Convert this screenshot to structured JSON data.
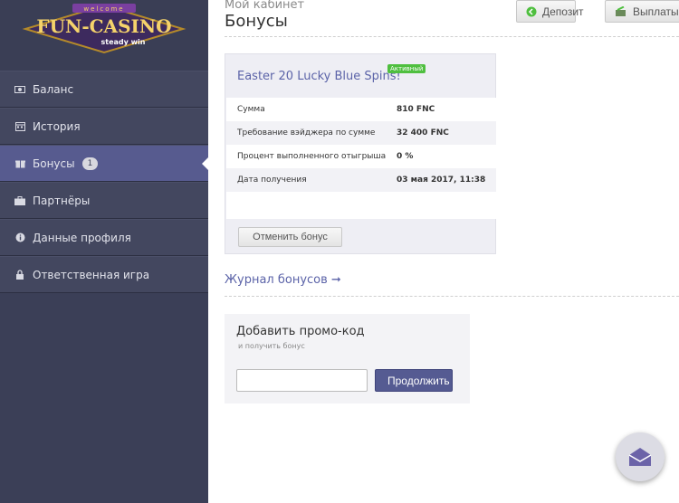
{
  "logo": {
    "top_text": "welcome",
    "main_text": "FUN-CASINO",
    "tagline": "steady win"
  },
  "sidebar": {
    "items": [
      {
        "label": "Баланс",
        "icon": "cash-icon"
      },
      {
        "label": "История",
        "icon": "calendar-icon"
      },
      {
        "label": "Бонусы",
        "icon": "gift-icon",
        "badge": "1",
        "active": true
      },
      {
        "label": "Партнёры",
        "icon": "briefcase-icon"
      },
      {
        "label": "Данные профиля",
        "icon": "info-icon"
      },
      {
        "label": "Ответственная игра",
        "icon": "lock-icon"
      }
    ]
  },
  "header": {
    "cabinet": "Мой кабинет",
    "title": "Бонусы",
    "deposit_label": "Депозит",
    "payout_label": "Выплаты"
  },
  "bonus": {
    "title": "Easter 20 Lucky Blue Spins!",
    "status": "Активный",
    "rows": [
      {
        "key": "Сумма",
        "value": "810 FNC"
      },
      {
        "key": "Требование вэйджера по сумме",
        "value": "32 400 FNC"
      },
      {
        "key": "Процент выполненного отыгрыша",
        "value": "0 %"
      },
      {
        "key": "Дата получения",
        "value": "03 мая 2017, 11:38"
      }
    ],
    "cancel_label": "Отменить бонус"
  },
  "journal_link": "Журнал бонусов ➞",
  "promo": {
    "title": "Добавить промо-код",
    "subtitle": "и получить бонус",
    "input_value": "",
    "button_label": "Продолжить"
  },
  "colors": {
    "sidebar": "#3b3f57",
    "accent": "#5b63a8",
    "active_item": "#575b8f",
    "status": "#4fbf3f"
  }
}
